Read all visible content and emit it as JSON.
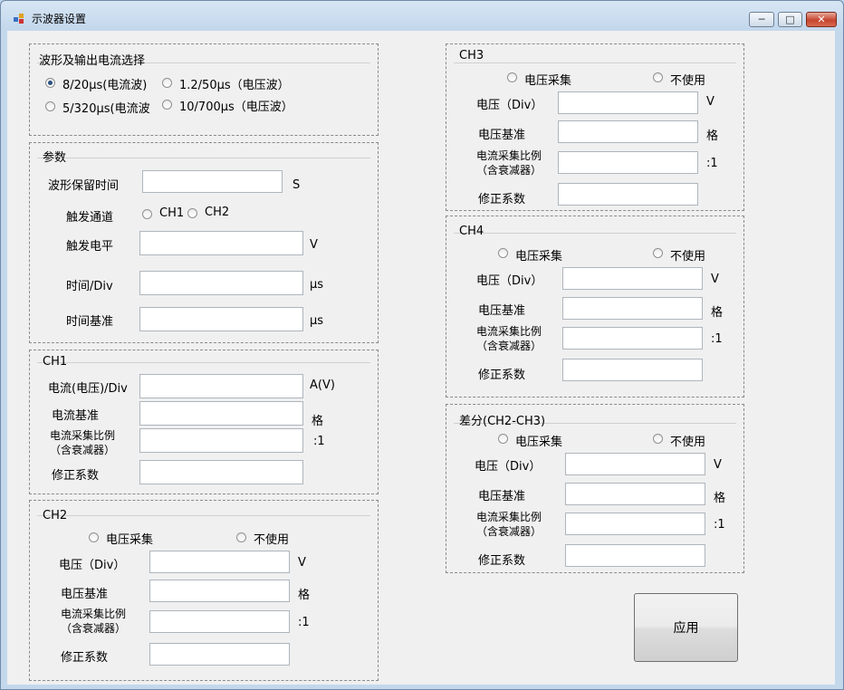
{
  "window": {
    "title": "示波器设置"
  },
  "waveform": {
    "legend": "波形及输出电流选择",
    "opt1": "8/20μs(电流波)",
    "opt2": "1.2/50μs（电压波）",
    "opt3": "5/320μs(电流波",
    "opt4": "10/700μs（电压波）",
    "selected": "8/20μs(电流波)"
  },
  "params": {
    "legend": "参数",
    "hold_time_label": "波形保留时间",
    "hold_time_unit": "S",
    "trigger_channel_label": "触发通道",
    "ch1": "CH1",
    "ch2": "CH2",
    "trigger_level_label": "触发电平",
    "trigger_level_unit": "V",
    "time_div_label": "时间/Div",
    "time_div_unit": "μs",
    "time_base_label": "时间基准",
    "time_base_unit": "μs"
  },
  "ch1": {
    "legend": "CH1",
    "div_label": "电流(电压)/Div",
    "div_unit": "A(V)",
    "base_label": "电流基准",
    "base_unit": "格",
    "ratio_label_1": "电流采集比例",
    "ratio_label_2": "（含衰减器）",
    "ratio_unit": ":1",
    "correction_label": "修正系数"
  },
  "ch2": {
    "legend": "CH2",
    "voltage_acq": "电压采集",
    "not_used": "不使用",
    "div_label": "电压（Div）",
    "div_unit": "V",
    "base_label": "电压基准",
    "base_unit": "格",
    "ratio_label_1": "电流采集比例",
    "ratio_label_2": "（含衰减器）",
    "ratio_unit": ":1",
    "correction_label": "修正系数"
  },
  "ch3": {
    "legend": "CH3",
    "voltage_acq": "电压采集",
    "not_used": "不使用",
    "div_label": "电压（Div）",
    "div_unit": "V",
    "base_label": "电压基准",
    "base_unit": "格",
    "ratio_label_1": "电流采集比例",
    "ratio_label_2": "（含衰减器）",
    "ratio_unit": ":1",
    "correction_label": "修正系数"
  },
  "ch4": {
    "legend": "CH4",
    "voltage_acq": "电压采集",
    "not_used": "不使用",
    "div_label": "电压（Div）",
    "div_unit": "V",
    "base_label": "电压基准",
    "base_unit": "格",
    "ratio_label_1": "电流采集比例",
    "ratio_label_2": "（含衰减器）",
    "ratio_unit": ":1",
    "correction_label": "修正系数"
  },
  "diff": {
    "legend": "差分(CH2-CH3)",
    "voltage_acq": "电压采集",
    "not_used": "不使用",
    "div_label": "电压（Div）",
    "div_unit": "V",
    "base_label": "电压基准",
    "base_unit": "格",
    "ratio_label_1": "电流采集比例",
    "ratio_label_2": "（含衰减器）",
    "ratio_unit": ":1",
    "correction_label": "修正系数"
  },
  "apply_button": "应用"
}
